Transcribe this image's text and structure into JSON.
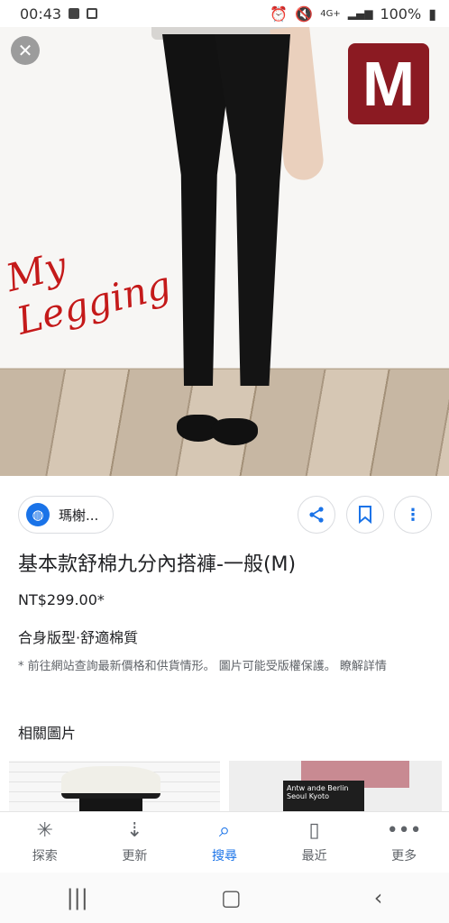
{
  "status_bar": {
    "time": "00:43",
    "network": "4G+",
    "battery": "100%"
  },
  "hero": {
    "logo_letter": "M",
    "script_text": "My Legging",
    "close_icon": "close-icon"
  },
  "result": {
    "source_label": "瑪榭...",
    "title": "基本款舒棉九分內搭褲-一般(M)",
    "price": "NT$299.00*",
    "description": "合身版型·舒適棉質",
    "disclaimer_prefix": "* 前往網站查詢最新價格和供貨情形。 圖片可能受版權保護。",
    "disclaimer_link": "瞭解詳情"
  },
  "related": {
    "title": "相關圖片",
    "thumb2_text": "Antw ande Berlin Seoul Kyoto"
  },
  "bottom_nav": [
    {
      "label": "探索",
      "icon": "asterisk-icon"
    },
    {
      "label": "更新",
      "icon": "inbox-icon"
    },
    {
      "label": "搜尋",
      "icon": "search-icon"
    },
    {
      "label": "最近",
      "icon": "recent-icon"
    },
    {
      "label": "更多",
      "icon": "more-icon"
    }
  ],
  "colors": {
    "accent": "#1a73e8",
    "logo_bg": "#8b1a22",
    "script_red": "#c41a1a"
  }
}
